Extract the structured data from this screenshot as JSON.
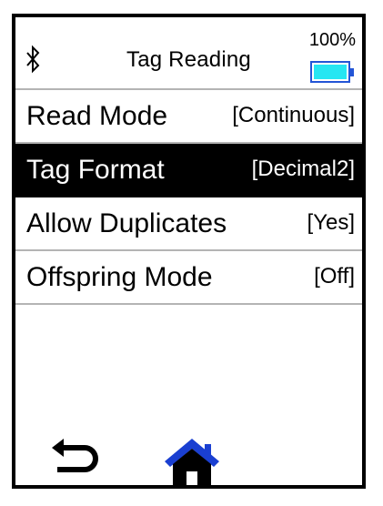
{
  "header": {
    "title": "Tag Reading",
    "bluetooth_icon": "bluetooth-icon",
    "battery_percent": "100%",
    "battery_level": 1.0,
    "battery_fill_color": "#26e6f2",
    "battery_outline_color": "#2355d6"
  },
  "menu": {
    "items": [
      {
        "label": "Read Mode",
        "value": "[Continuous]",
        "selected": false
      },
      {
        "label": "Tag Format",
        "value": "[Decimal2]",
        "selected": true
      },
      {
        "label": "Allow Duplicates",
        "value": "[Yes]",
        "selected": false
      },
      {
        "label": "Offspring Mode",
        "value": "[Off]",
        "selected": false
      }
    ]
  },
  "footer": {
    "back_icon": "back-arrow-icon",
    "home_icon": "home-icon",
    "home_color": "#1a3fd1"
  }
}
